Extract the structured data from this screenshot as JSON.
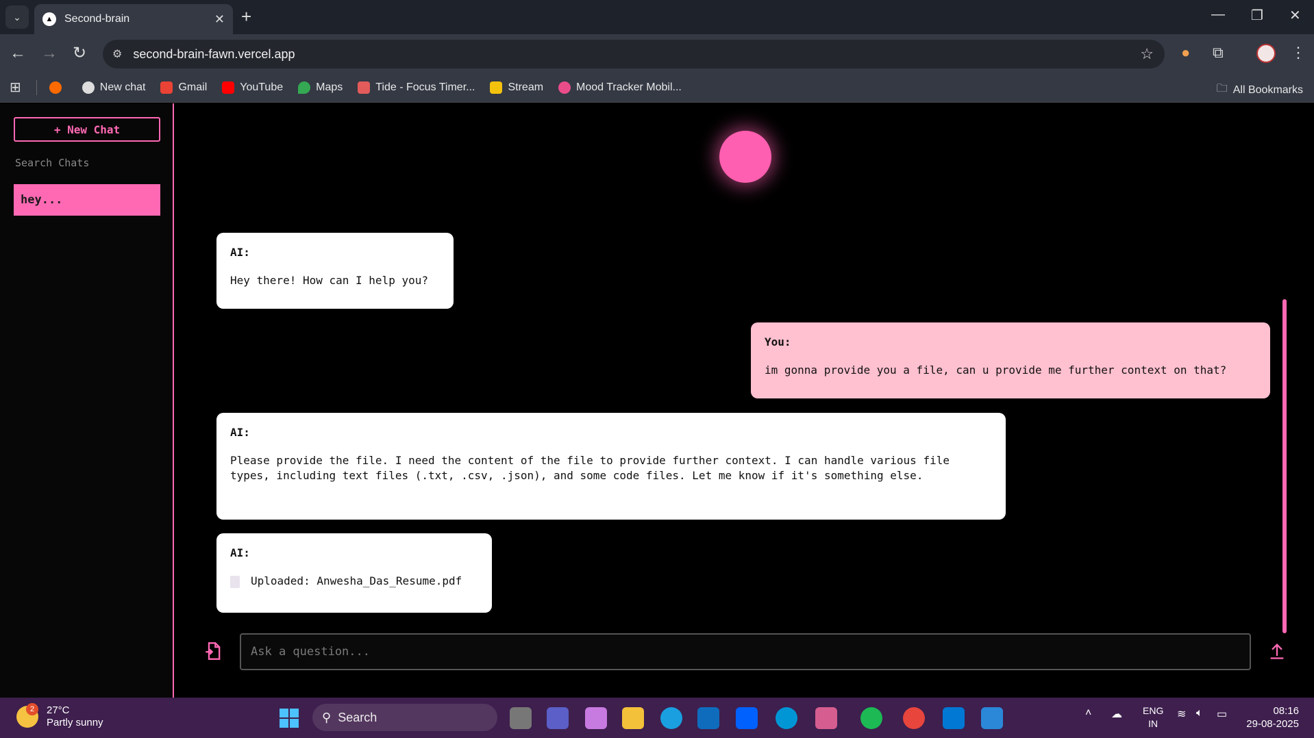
{
  "browser": {
    "tab_title": "Second-brain",
    "url": "second-brain-fawn.vercel.app",
    "bookmarks": [
      "New chat",
      "Gmail",
      "YouTube",
      "Maps",
      "Tide - Focus Timer...",
      "Stream",
      "Mood Tracker Mobil..."
    ],
    "all_bookmarks": "All Bookmarks"
  },
  "sidebar": {
    "new_chat_label": "+ New Chat",
    "search_placeholder": "Search Chats",
    "chats": [
      "hey..."
    ]
  },
  "messages": [
    {
      "sender": "AI:",
      "text": "Hey there! How can I help you?"
    },
    {
      "sender": "You:",
      "text": "im gonna provide you a file, can u provide me further context on that?"
    },
    {
      "sender": "AI:",
      "text": "Please provide the file. I need the content of the file to provide further context. I can handle various file types, including text files (.txt, .csv, .json), and some code files. Let me know if it's something else."
    },
    {
      "sender": "AI:",
      "text": "Uploaded: Anwesha_Das_Resume.pdf"
    }
  ],
  "composer": {
    "placeholder": "Ask a question..."
  },
  "taskbar": {
    "weather_temp": "27°C",
    "weather_desc": "Partly sunny",
    "weather_badge": "2",
    "search_label": "Search",
    "lang_top": "ENG",
    "lang_bottom": "IN",
    "time": "08:16",
    "date": "29-08-2025"
  },
  "colors": {
    "accent": "#ff69b4",
    "user_bubble": "#ffc0d0",
    "ai_bubble": "#ffffff"
  }
}
